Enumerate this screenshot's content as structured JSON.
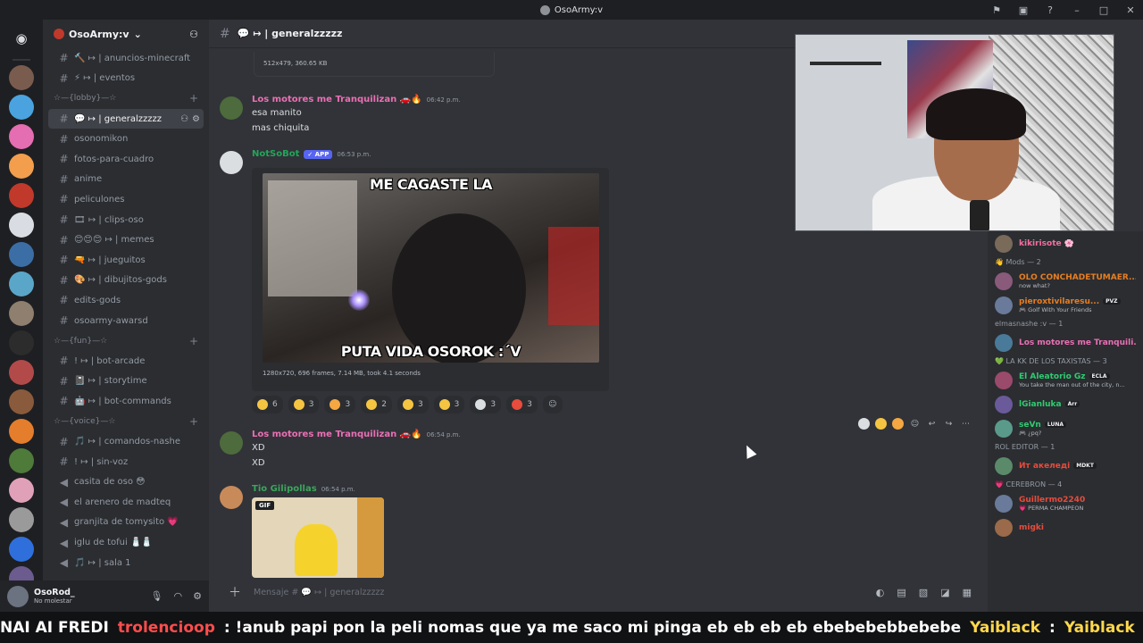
{
  "window": {
    "title": "OsoArmy:v"
  },
  "guild": {
    "name": "OsoArmy:v"
  },
  "channel_list": [
    {
      "kind": "channel",
      "label": "🔨 ↦ | anuncios-minecraft"
    },
    {
      "kind": "channel",
      "label": "⚡ ↦ | eventos"
    },
    {
      "kind": "category",
      "label": "☆—{lobby}—☆"
    },
    {
      "kind": "channel",
      "label": "💬 ↦ | generalzzzzz",
      "active": true
    },
    {
      "kind": "channel",
      "label": "osonomikon"
    },
    {
      "kind": "channel",
      "label": "fotos-para-cuadro"
    },
    {
      "kind": "channel",
      "label": "anime"
    },
    {
      "kind": "channel",
      "label": "peliculones"
    },
    {
      "kind": "channel",
      "label": "🎞 ↦ | clips-oso"
    },
    {
      "kind": "channel",
      "label": "😊😊😊 ↦ | memes"
    },
    {
      "kind": "channel",
      "label": "🔫 ↦ | jueguitos"
    },
    {
      "kind": "channel",
      "label": "🎨 ↦ | dibujitos-gods"
    },
    {
      "kind": "channel",
      "label": "edits-gods"
    },
    {
      "kind": "channel",
      "label": "osoarmy-awarsd"
    },
    {
      "kind": "category",
      "label": "☆—{fun}—☆"
    },
    {
      "kind": "channel",
      "label": "! ↦ | bot-arcade"
    },
    {
      "kind": "channel",
      "label": "📓 ↦ | storytime"
    },
    {
      "kind": "channel",
      "label": "🤖 ↦ | bot-commands"
    },
    {
      "kind": "category",
      "label": "☆—{voice}—☆"
    },
    {
      "kind": "channel",
      "label": "🎵 ↦ | comandos-nashe"
    },
    {
      "kind": "channel",
      "label": "! ↦ | sin-voz"
    },
    {
      "kind": "voice",
      "label": "casita de oso 😳"
    },
    {
      "kind": "voice",
      "label": "el arenero de madteq"
    },
    {
      "kind": "voice",
      "label": "granjita de tomysito 💗"
    },
    {
      "kind": "voice",
      "label": "iglu de tofui 🧂🧂"
    },
    {
      "kind": "voice",
      "label": "🎵 ↦ | sala 1"
    }
  ],
  "user": {
    "name": "OsoRod_",
    "status": "No molestar"
  },
  "header": {
    "channel": "💬 ↦ | generalzzzzz"
  },
  "file_info": "512x479, 360.65 KB",
  "messages": {
    "m1": {
      "author": "Los motores me Tranquilizan 🚗🔥",
      "time": "06:42 p.m.",
      "lines": [
        "esa manito",
        "mas chiquita"
      ]
    },
    "m2": {
      "author": "NotSoBot",
      "badge": "✓ APP",
      "time": "06:53 p.m.",
      "caption_top": "ME CAGASTE LA",
      "caption_bottom": "PUTA VIDA OSOROK :´V",
      "meta": "1280x720, 696 frames, 7.14 MB, took 4.1 seconds"
    },
    "m3": {
      "author": "Los motores me Tranquilizan 🚗🔥",
      "time": "06:54 p.m.",
      "lines": [
        "XD",
        "XD"
      ]
    },
    "m4": {
      "author": "Tio Gilipollas",
      "time": "06:54 p.m.",
      "gif_tag": "GIF"
    }
  },
  "reactions": [
    {
      "count": "6",
      "color": "#f5c542"
    },
    {
      "count": "3",
      "color": "#f5c542"
    },
    {
      "count": "3",
      "color": "#f5a742"
    },
    {
      "count": "2",
      "color": "#f5c542"
    },
    {
      "count": "3",
      "color": "#f5c542"
    },
    {
      "count": "3",
      "color": "#f5c542"
    },
    {
      "count": "3",
      "color": "#dbdee1"
    },
    {
      "count": "3",
      "color": "#e74c3c"
    }
  ],
  "composer": {
    "placeholder": "Mensaje # 💬 ↦ | generalzzzzz"
  },
  "members": [
    {
      "kind": "member",
      "name": "kikirisote 🌸",
      "color": "#f36fa0"
    },
    {
      "kind": "category",
      "label": "👋 Mods — 2"
    },
    {
      "kind": "member",
      "name": "OLO CONCHADETUMAER...",
      "status": "now what?",
      "color": "#e67e22"
    },
    {
      "kind": "member",
      "name": "pieroxtivilaresu...",
      "status": "🎮 Golf With Your Friends",
      "badge": "PVZ",
      "color": "#e67e22"
    },
    {
      "kind": "category",
      "label": "elmasnashe :v — 1"
    },
    {
      "kind": "member",
      "name": "Los motores me Tranquili...",
      "color": "#eb6fb4"
    },
    {
      "kind": "category",
      "label": "💚 LA KK DE LOS TAXISTAS — 3"
    },
    {
      "kind": "member",
      "name": "El Aleatorio Gz",
      "status": "You take the man out of the city, n...",
      "badge": "ECLA",
      "color": "#2ecc71"
    },
    {
      "kind": "member",
      "name": "lGianluka",
      "badge": "Arr",
      "color": "#2ecc71"
    },
    {
      "kind": "member",
      "name": "seVn",
      "status": "🎮 ¿pq?",
      "badge": "LUNA",
      "color": "#2ecc71"
    },
    {
      "kind": "category",
      "label": "ROL EDITOR — 1"
    },
    {
      "kind": "member",
      "name": "Ит акеледі",
      "badge": "MDKT",
      "color": "#e74c3c"
    },
    {
      "kind": "category",
      "label": "💗 CEREBRON — 4"
    },
    {
      "kind": "member",
      "name": "Guillermo2240",
      "status": "💗 PERMA CHAMPEON",
      "color": "#e74c3c"
    },
    {
      "kind": "member",
      "name": "migki",
      "color": "#e74c3c"
    }
  ],
  "ticker": {
    "part1": "NAI AI FREDI",
    "nick1": "trolencioop",
    "msg1": ": !anub papi pon la peli nomas que ya me saco mi pinga eb eb eb eb ebebebebbebebe",
    "nick2": "Yaiblack",
    "msg2": ":",
    "nick3": "Yaiblack",
    "msg3": ":"
  },
  "colors": {
    "accent": "#5865f2",
    "mention_pink": "#eb6fb4",
    "bot_green": "#23a559",
    "tio_green": "#3ba55c"
  }
}
